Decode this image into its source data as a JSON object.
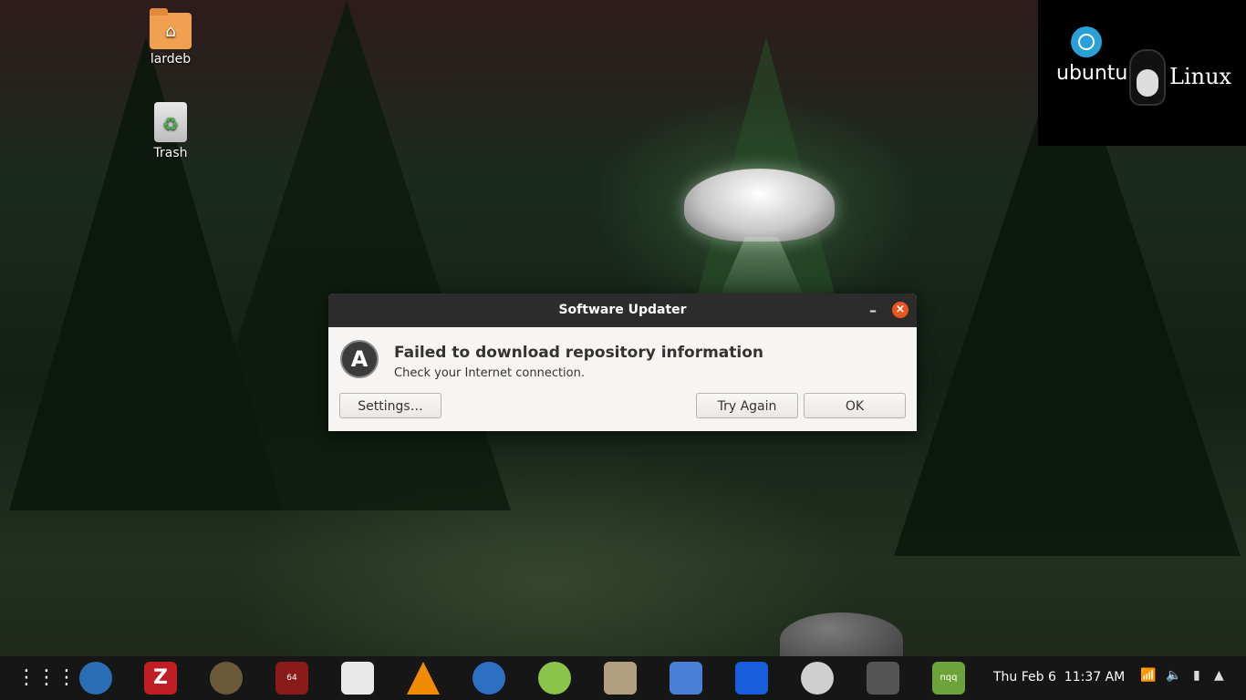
{
  "desktop": {
    "icons": [
      {
        "label": "lardeb"
      },
      {
        "label": "Trash"
      }
    ]
  },
  "branding": {
    "ubuntu_text": "ubuntu",
    "linux_text": "Linux"
  },
  "dialog": {
    "title": "Software Updater",
    "minimize_glyph": "–",
    "close_glyph": "×",
    "heading": "Failed to download repository information",
    "message": "Check your Internet connection.",
    "buttons": {
      "settings": "Settings…",
      "try_again": "Try Again",
      "ok": "OK"
    }
  },
  "taskbar": {
    "clock": "Thu Feb 6  11:37 AM",
    "apps": [
      {
        "icon": "bluefish-icon",
        "color": "#2a6fb5"
      },
      {
        "icon": "filezilla-icon",
        "color": "#bf1e24"
      },
      {
        "icon": "gimp-icon",
        "color": "#6a5a3a"
      },
      {
        "icon": "app-64-icon",
        "color": "#8a1a1a"
      },
      {
        "icon": "app-tiles-icon",
        "color": "#e9e9e9"
      },
      {
        "icon": "vlc-icon",
        "color": "#f08a00"
      },
      {
        "icon": "thunderbird-icon",
        "color": "#2d6fc0"
      },
      {
        "icon": "app-green-icon",
        "color": "#8bc34a"
      },
      {
        "icon": "disk-usage-icon",
        "color": "#b0a080"
      },
      {
        "icon": "screenshot-icon",
        "color": "#4a7fd6"
      },
      {
        "icon": "bitwarden-icon",
        "color": "#175ddc"
      },
      {
        "icon": "disk-icon",
        "color": "#cfcfcf"
      },
      {
        "icon": "pin-icon",
        "color": "#555555"
      },
      {
        "icon": "nqq-icon",
        "color": "#6da33a"
      }
    ],
    "nqq_label": "nqq",
    "app_64_label": "64"
  },
  "colors": {
    "accent": "#e95420",
    "titlebar": "#2c2c2c",
    "dialog_bg": "#f6f5f4",
    "taskbar": "#161616"
  }
}
